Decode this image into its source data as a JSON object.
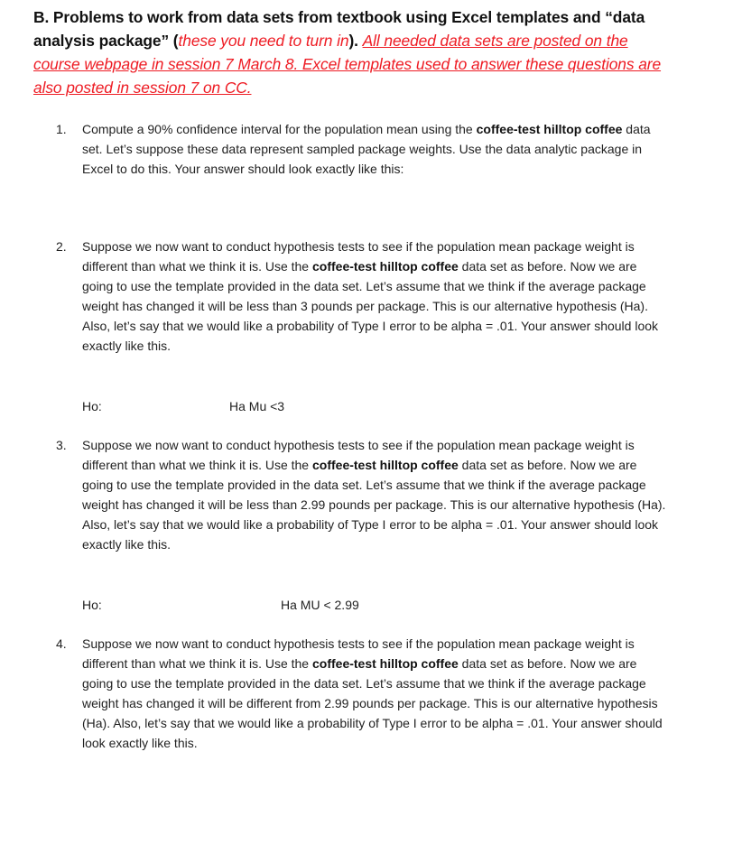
{
  "heading": {
    "prefix": "B. Problems to work from data sets from textbook using Excel templates and “data analysis package” (",
    "red_italic": "these you need to turn in",
    "close_paren": "). ",
    "red_underline": "All needed data sets are posted on the course webpage in session 7 March 8. Excel templates used to answer these questions are also posted in session 7 on CC."
  },
  "colors": {
    "accent_red": "#ee1c24",
    "text": "#222222"
  },
  "items": [
    {
      "number": "1.",
      "text_before_bold": "Compute a 90% confidence interval for the population mean using the ",
      "bold": "coffee-test hilltop coffee",
      "text_after_bold": " data set. Let’s suppose these data represent sampled package weights. Use the data analytic package in Excel to do this. Your answer should look exactly like this:"
    },
    {
      "number": "2.",
      "text_before_bold": "Suppose we now want to conduct hypothesis tests to see if the population mean package weight is different than what we think it is. Use the ",
      "bold": "coffee-test hilltop coffee",
      "text_after_bold": " data set as before. Now we are going to use the template provided in the data set. Let’s assume that we think if the average package weight has changed it will be less than 3 pounds per package. This is our alternative hypothesis (Ha). Also, let’s say that we would like a probability of Type I error to be alpha = .01. Your answer should look exactly like this.",
      "ho_label": "Ho:",
      "ha_label": "Ha Mu <3"
    },
    {
      "number": "3.",
      "text_before_bold": "Suppose we now want to conduct hypothesis tests to see if the population mean package weight is different than what we think it is. Use the ",
      "bold": "coffee-test hilltop coffee",
      "text_after_bold": " data set as before. Now we are going to use the template provided in the data set. Let’s assume that we think if the average package weight has changed it will be less than 2.99 pounds per package. This is our alternative hypothesis (Ha). Also, let’s say that we would like a probability of Type I error to be alpha = .01. Your answer should look exactly like this.",
      "ho_label": "Ho:",
      "ha_label": "Ha MU < 2.99"
    },
    {
      "number": "4.",
      "text_before_bold": "Suppose we now want to conduct hypothesis tests to see if the population mean package weight is different than what we think it is. Use the ",
      "bold": "coffee-test hilltop coffee",
      "text_after_bold": " data set as before. Now we are going to use the template provided in the data set. Let’s assume that we think if the average package weight has changed it will be different from 2.99 pounds per package. This is our alternative hypothesis (Ha). Also, let’s say that we would like a probability of Type I error to be alpha = .01. Your answer should look exactly like this."
    }
  ]
}
